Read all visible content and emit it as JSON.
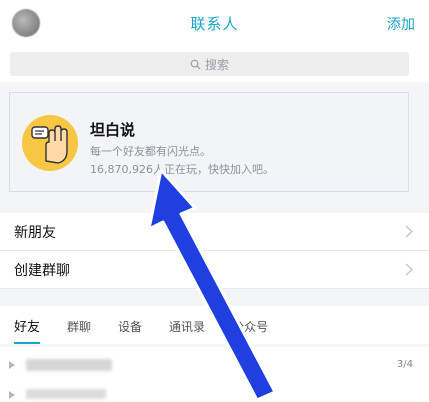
{
  "header": {
    "title": "联系人",
    "add_label": "添加"
  },
  "search": {
    "placeholder": "搜索"
  },
  "banner": {
    "title": "坦白说",
    "subtitle": "每一个好友都有闪光点。",
    "count_text": "16,870,926人正在玩，快快加入吧。"
  },
  "list": {
    "items": [
      {
        "label": "新朋友"
      },
      {
        "label": "创建群聊"
      }
    ]
  },
  "tabs": [
    {
      "label": "好友",
      "active": true
    },
    {
      "label": "群聊"
    },
    {
      "label": "设备"
    },
    {
      "label": "通讯录"
    },
    {
      "label": "公众号"
    }
  ],
  "group": {
    "count": "3/4"
  },
  "colors": {
    "accent": "#1aa6c8",
    "arrow": "#1f3fe0",
    "banner_icon": "#f7c744"
  },
  "icons": {
    "search": "search-icon",
    "chevron": "chevron-right-icon",
    "banner": "hand-speech-icon"
  }
}
